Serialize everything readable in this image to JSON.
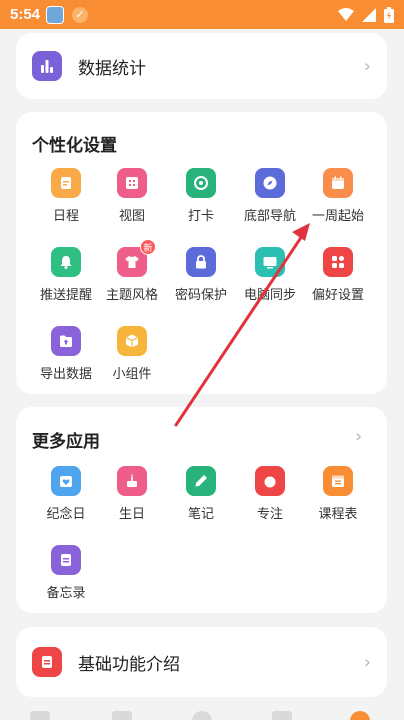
{
  "status_bar": {
    "time": "5:54"
  },
  "data_stats": {
    "label": "数据统计",
    "color": "#7b61d8"
  },
  "personalize": {
    "title": "个性化设置",
    "items": [
      {
        "label": "日程",
        "icon": "calendar-note-icon",
        "color": "#f9a947"
      },
      {
        "label": "视图",
        "icon": "grid-icon",
        "color": "#ef5e8a"
      },
      {
        "label": "打卡",
        "icon": "target-check-icon",
        "color": "#29b37c"
      },
      {
        "label": "底部导航",
        "icon": "compass-icon",
        "color": "#5b6bd9"
      },
      {
        "label": "一周起始",
        "icon": "calendar-icon",
        "color": "#f98d4b"
      },
      {
        "label": "推送提醒",
        "icon": "bell-icon",
        "color": "#2fbf82"
      },
      {
        "label": "主题风格",
        "icon": "shirt-icon",
        "color": "#ef5e8a",
        "badge": "新"
      },
      {
        "label": "密码保护",
        "icon": "lock-icon",
        "color": "#5b6bd9"
      },
      {
        "label": "电脑同步",
        "icon": "monitor-icon",
        "color": "#2bbfb2"
      },
      {
        "label": "偏好设置",
        "icon": "tiles-icon",
        "color": "#ee4646"
      },
      {
        "label": "导出数据",
        "icon": "folder-export-icon",
        "color": "#8a63db"
      },
      {
        "label": "小组件",
        "icon": "cube-icon",
        "color": "#f7b53b"
      }
    ]
  },
  "more_apps": {
    "title": "更多应用",
    "items": [
      {
        "label": "纪念日",
        "icon": "heart-calendar-icon",
        "color": "#4fa4ee"
      },
      {
        "label": "生日",
        "icon": "cake-icon",
        "color": "#ef5e8a"
      },
      {
        "label": "笔记",
        "icon": "pen-icon",
        "color": "#29b37c"
      },
      {
        "label": "专注",
        "icon": "tomato-icon",
        "color": "#ee4646"
      },
      {
        "label": "课程表",
        "icon": "schedule-icon",
        "color": "#f98d34"
      },
      {
        "label": "备忘录",
        "icon": "memo-icon",
        "color": "#8a63db"
      }
    ]
  },
  "basic_intro": {
    "label": "基础功能介绍",
    "color": "#ee4646"
  },
  "annotation": {
    "arrow_color": "#e0333d"
  }
}
